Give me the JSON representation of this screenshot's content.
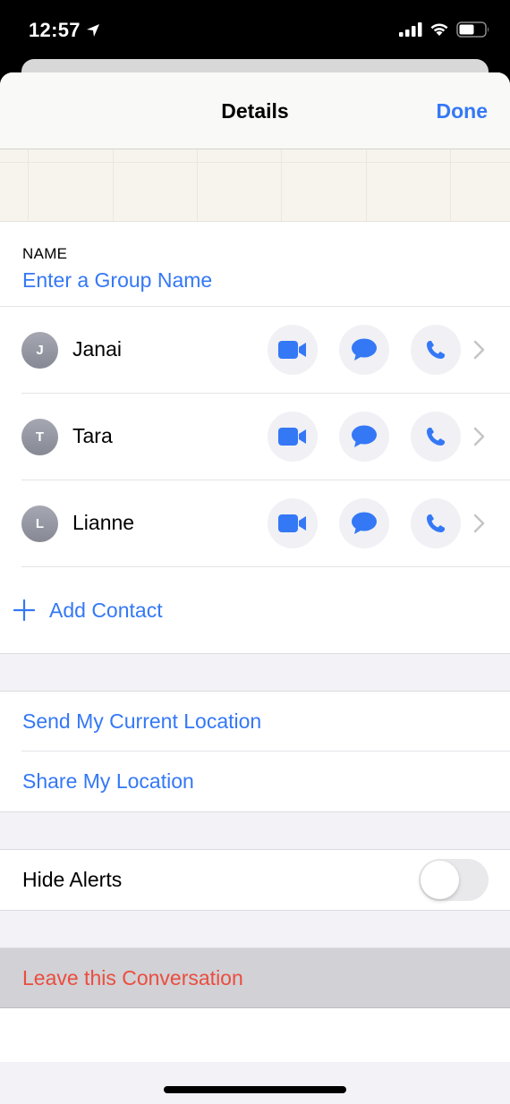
{
  "status_bar": {
    "time": "12:57",
    "location_icon": "location-arrow-icon",
    "signal_icon": "cellular-signal-icon",
    "wifi_icon": "wifi-icon",
    "battery_icon": "battery-icon",
    "battery_level_percent": 55
  },
  "nav": {
    "title": "Details",
    "done_label": "Done"
  },
  "name_section": {
    "label": "NAME",
    "placeholder": "Enter a Group Name",
    "value": ""
  },
  "contacts": [
    {
      "initial": "J",
      "name": "Janai"
    },
    {
      "initial": "T",
      "name": "Tara"
    },
    {
      "initial": "L",
      "name": "Lianne"
    }
  ],
  "contact_actions": {
    "video_icon": "video-camera-icon",
    "message_icon": "message-bubble-icon",
    "phone_icon": "phone-icon",
    "chevron_icon": "chevron-right-icon"
  },
  "add_contact": {
    "label": "Add Contact",
    "icon": "plus-icon"
  },
  "location": {
    "send_current": "Send My Current Location",
    "share": "Share My Location"
  },
  "alerts": {
    "label": "Hide Alerts",
    "enabled": false
  },
  "leave": {
    "label": "Leave this Conversation"
  },
  "colors": {
    "accent": "#3478f6",
    "destructive": "#eb4d3d",
    "group_bg": "#f2f2f7",
    "action_bg": "#f0f0f5"
  }
}
